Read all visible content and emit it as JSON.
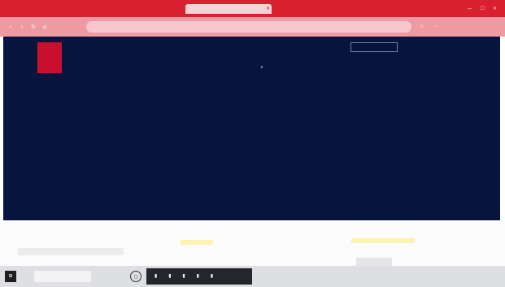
{
  "browser": {
    "tabs": [
      {
        "label": ""
      },
      {
        "label": ""
      },
      {
        "label": ""
      },
      {
        "label": ""
      }
    ],
    "close_glyph": "×",
    "window_controls": "— ☐ ✕",
    "nav": {
      "back": "‹",
      "forward": "›",
      "reload": "↻",
      "home": "⌂"
    },
    "address": "",
    "toolbar_icons": "☆ ⋯"
  },
  "site": {
    "logo_glyph": "",
    "institution_lines": [
      "",
      "",
      ""
    ],
    "search_placeholder": "",
    "utility_links": "",
    "nav_items": [
      "",
      "",
      "",
      ""
    ],
    "nav_search_icon": "⌕"
  },
  "below": {
    "mini_dialog": ""
  },
  "taskbar": {
    "start_glyph": "⊞",
    "search_text": "",
    "cortana_glyph": "○",
    "apps": "▮ ▮ ▮ ▮ ▮",
    "tray": ""
  },
  "colors": {
    "tab_bar": "#d9202e",
    "toolbar": "#ef9aa2",
    "page_background": "#07143d",
    "logo": "#c8102e"
  }
}
